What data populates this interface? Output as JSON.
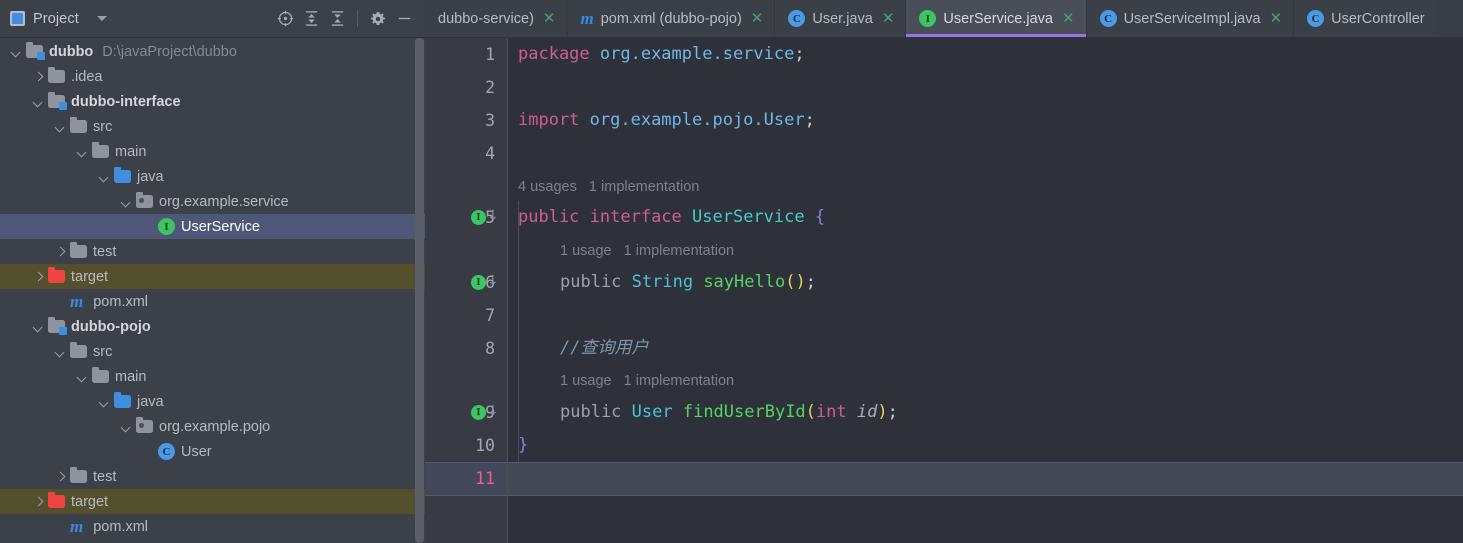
{
  "window": {
    "theme_bg": "#3c4048",
    "editor_bg": "#2e3139",
    "accent_purple": "#9876e0"
  },
  "project_toolbar": {
    "title": "Project",
    "icons": [
      {
        "name": "locate-file-icon",
        "glyph": "locate"
      },
      {
        "name": "expand-all-icon",
        "glyph": "expand"
      },
      {
        "name": "collapse-all-icon",
        "glyph": "collapse"
      },
      {
        "name": "settings-gear-icon",
        "glyph": "gear"
      },
      {
        "name": "minimize-icon",
        "glyph": "minus"
      }
    ]
  },
  "tabs": [
    {
      "label": "dubbo-service)",
      "icon": "maven-icon",
      "icon_kind": "maven",
      "active": false,
      "truncated_left": true,
      "close": "✕"
    },
    {
      "label": "pom.xml (dubbo-pojo)",
      "icon": "maven-icon",
      "icon_kind": "maven",
      "active": false,
      "close": "✕"
    },
    {
      "label": "User.java",
      "icon": "class-icon",
      "icon_kind": "class",
      "icon_letter": "C",
      "active": false,
      "close": "✕"
    },
    {
      "label": "UserService.java",
      "icon": "interface-icon",
      "icon_kind": "interface",
      "icon_letter": "I",
      "active": true,
      "close": "✕"
    },
    {
      "label": "UserServiceImpl.java",
      "icon": "class-icon",
      "icon_kind": "class",
      "icon_letter": "C",
      "active": false,
      "close": "✕"
    },
    {
      "label": "UserController",
      "icon": "class-icon",
      "icon_kind": "class",
      "icon_letter": "C",
      "active": false,
      "close": ""
    }
  ],
  "tree": [
    {
      "depth": 0,
      "arrow": "down",
      "icon": "module-folder-icon",
      "label": "dubbo",
      "bold": true,
      "path": "D:\\javaProject\\dubbo"
    },
    {
      "depth": 1,
      "arrow": "right",
      "icon": "folder-icon",
      "label": ".idea"
    },
    {
      "depth": 1,
      "arrow": "down",
      "icon": "module-folder-icon",
      "label": "dubbo-interface",
      "bold": true
    },
    {
      "depth": 2,
      "arrow": "down",
      "icon": "folder-icon",
      "label": "src"
    },
    {
      "depth": 3,
      "arrow": "down",
      "icon": "folder-icon",
      "label": "main"
    },
    {
      "depth": 4,
      "arrow": "down",
      "icon": "source-folder-icon",
      "label": "java"
    },
    {
      "depth": 5,
      "arrow": "down",
      "icon": "package-icon",
      "label": "org.example.service"
    },
    {
      "depth": 6,
      "arrow": "none",
      "icon": "interface-icon",
      "label": "UserService",
      "selected": true
    },
    {
      "depth": 2,
      "arrow": "right",
      "icon": "folder-icon",
      "label": "test"
    },
    {
      "depth": 1,
      "arrow": "right",
      "icon": "excluded-folder-icon",
      "label": "target",
      "highlight": true
    },
    {
      "depth": 2,
      "arrow": "none",
      "icon": "maven-icon",
      "label": "pom.xml"
    },
    {
      "depth": 1,
      "arrow": "down",
      "icon": "module-folder-icon",
      "label": "dubbo-pojo",
      "bold": true
    },
    {
      "depth": 2,
      "arrow": "down",
      "icon": "folder-icon",
      "label": "src"
    },
    {
      "depth": 3,
      "arrow": "down",
      "icon": "folder-icon",
      "label": "main"
    },
    {
      "depth": 4,
      "arrow": "down",
      "icon": "source-folder-icon",
      "label": "java"
    },
    {
      "depth": 5,
      "arrow": "down",
      "icon": "package-icon",
      "label": "org.example.pojo"
    },
    {
      "depth": 6,
      "arrow": "none",
      "icon": "class-icon",
      "label": "User"
    },
    {
      "depth": 2,
      "arrow": "right",
      "icon": "folder-icon",
      "label": "test"
    },
    {
      "depth": 1,
      "arrow": "right",
      "icon": "excluded-folder-icon",
      "label": "target",
      "highlight": true
    },
    {
      "depth": 2,
      "arrow": "none",
      "icon": "maven-icon",
      "label": "pom.xml"
    }
  ],
  "editor": {
    "file": "UserService.java",
    "line_numbers": [
      "1",
      "2",
      "3",
      "4",
      "5",
      "6",
      "7",
      "8",
      "9",
      "10",
      "11"
    ],
    "current_line": "11",
    "gutter_marked_lines": [
      "5",
      "6",
      "9"
    ],
    "code": {
      "l1_kw": "package",
      "l1_pkg": " org.example.service",
      "l1_semi": ";",
      "l3_kw": "import",
      "l3_pkg": " org.example.pojo.User",
      "l3_semi": ";",
      "hint5": "4 usages   1 implementation",
      "l5_kw1": "public",
      "l5_kw2": " interface",
      "l5_name": " UserService",
      "l5_brace": " {",
      "hint6": "1 usage   1 implementation",
      "l6_kw": "public",
      "l6_type": " String",
      "l6_name": " sayHello",
      "l6_paren": "()",
      "l6_semi": ";",
      "l8_comment": "//查询用户",
      "hint9": "1 usage   1 implementation",
      "l9_kw": "public",
      "l9_type": " User",
      "l9_name": " findUserById",
      "l9_open": "(",
      "l9_ptype": "int",
      "l9_pname": " id",
      "l9_close": ")",
      "l9_semi": ";",
      "l10_brace": "}"
    }
  }
}
